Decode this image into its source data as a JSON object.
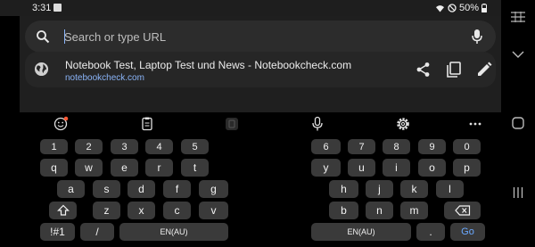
{
  "status_bar": {
    "time": "3:31",
    "battery": "50%"
  },
  "browser": {
    "search_placeholder": "Search or type URL",
    "suggestion": {
      "title": "Notebook Test, Laptop Test und News - Notebookcheck.com",
      "url": "notebookcheck.com"
    }
  },
  "keyboard": {
    "left": {
      "numbers": [
        "1",
        "2",
        "3",
        "4",
        "5"
      ],
      "row1": [
        "q",
        "w",
        "e",
        "r",
        "t"
      ],
      "row2": [
        "a",
        "s",
        "d",
        "f",
        "g"
      ],
      "row3": [
        "z",
        "x",
        "c",
        "v"
      ],
      "symbols_label": "!#1",
      "slash_label": "/",
      "space_label": "EN(AU)"
    },
    "right": {
      "numbers": [
        "6",
        "7",
        "8",
        "9",
        "0"
      ],
      "row1": [
        "y",
        "u",
        "i",
        "o",
        "p"
      ],
      "row2": [
        "h",
        "j",
        "k",
        "l"
      ],
      "row3": [
        "b",
        "n",
        "m"
      ],
      "space_label": "EN(AU)",
      "dot_label": ".",
      "go_label": "Go"
    }
  },
  "colors": {
    "accent": "#8ab4f8",
    "go": "#6aa9ff",
    "badge": "#ff5a36"
  },
  "icons": [
    "image-icon",
    "wifi-icon",
    "dnd-icon",
    "battery-icon",
    "search-icon",
    "mic-icon",
    "globe-icon",
    "share-icon",
    "copy-icon",
    "edit-icon",
    "emoji-icon",
    "clipboard-icon",
    "one-handed-icon",
    "voice-icon",
    "settings-icon",
    "more-icon",
    "shift-icon",
    "backspace-icon",
    "split-screen-icon",
    "chevron-down-icon",
    "home-icon",
    "recents-icon"
  ]
}
